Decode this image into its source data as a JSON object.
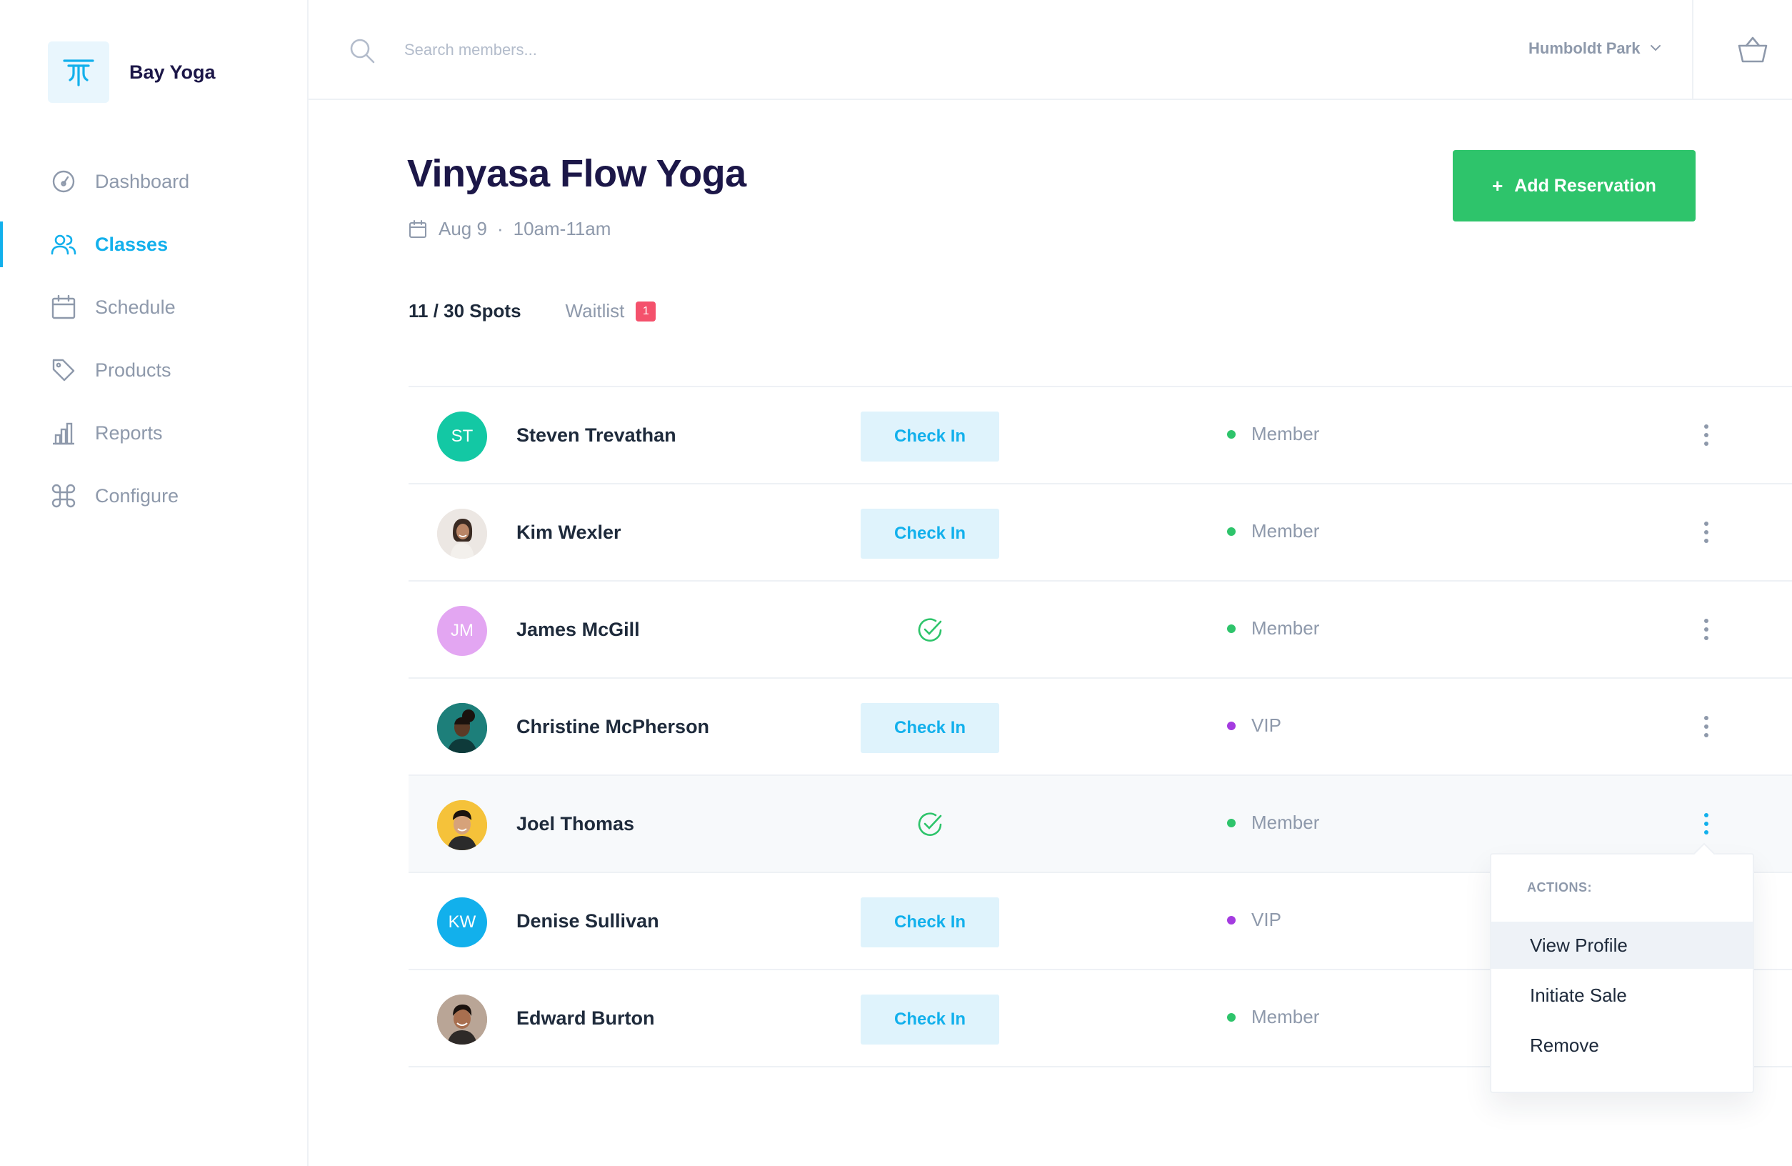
{
  "brand": {
    "name": "Bay Yoga",
    "logo_icon": "yoga-logo-icon",
    "accent": "#12b0ec"
  },
  "nav": {
    "items": [
      {
        "label": "Dashboard",
        "icon": "gauge-icon",
        "active": false
      },
      {
        "label": "Classes",
        "icon": "users-icon",
        "active": true
      },
      {
        "label": "Schedule",
        "icon": "calendar-icon",
        "active": false
      },
      {
        "label": "Products",
        "icon": "tag-icon",
        "active": false
      },
      {
        "label": "Reports",
        "icon": "bar-chart-icon",
        "active": false
      },
      {
        "label": "Configure",
        "icon": "command-icon",
        "active": false
      }
    ]
  },
  "header": {
    "search_placeholder": "Search members...",
    "location": "Humboldt Park"
  },
  "page": {
    "title": "Vinyasa Flow Yoga",
    "date": "Aug 9",
    "separator": "·",
    "time": "10am-11am",
    "add_button": "Add Reservation",
    "add_button_color": "#2ec46b"
  },
  "tabs": {
    "spots": "11 / 30 Spots",
    "waitlist": "Waitlist",
    "waitlist_count": "1"
  },
  "members": [
    {
      "name": "Steven Trevathan",
      "initials": "ST",
      "avatar_color": "#13c8a4",
      "checked_in": false,
      "status": "Member",
      "status_color": "#2ec46b"
    },
    {
      "name": "Kim Wexler",
      "initials": "",
      "avatar_color": "#e9e4df",
      "checked_in": false,
      "status": "Member",
      "status_color": "#2ec46b"
    },
    {
      "name": "James McGill",
      "initials": "JM",
      "avatar_color": "#e3a6f2",
      "checked_in": true,
      "status": "Member",
      "status_color": "#2ec46b"
    },
    {
      "name": "Christine McPherson",
      "initials": "",
      "avatar_color": "#1d7f7a",
      "checked_in": false,
      "status": "VIP",
      "status_color": "#a43be0"
    },
    {
      "name": "Joel Thomas",
      "initials": "",
      "avatar_color": "#f5c23a",
      "checked_in": true,
      "status": "Member",
      "status_color": "#2ec46b"
    },
    {
      "name": "Denise Sullivan",
      "initials": "KW",
      "avatar_color": "#12b0ec",
      "checked_in": false,
      "status": "VIP",
      "status_color": "#a43be0"
    },
    {
      "name": "Edward Burton",
      "initials": "",
      "avatar_color": "#b9a596",
      "checked_in": false,
      "status": "Member",
      "status_color": "#2ec46b"
    }
  ],
  "check_in_label": "Check In",
  "dropdown": {
    "title": "ACTIONS:",
    "items": [
      "View Profile",
      "Initiate Sale",
      "Remove"
    ]
  }
}
